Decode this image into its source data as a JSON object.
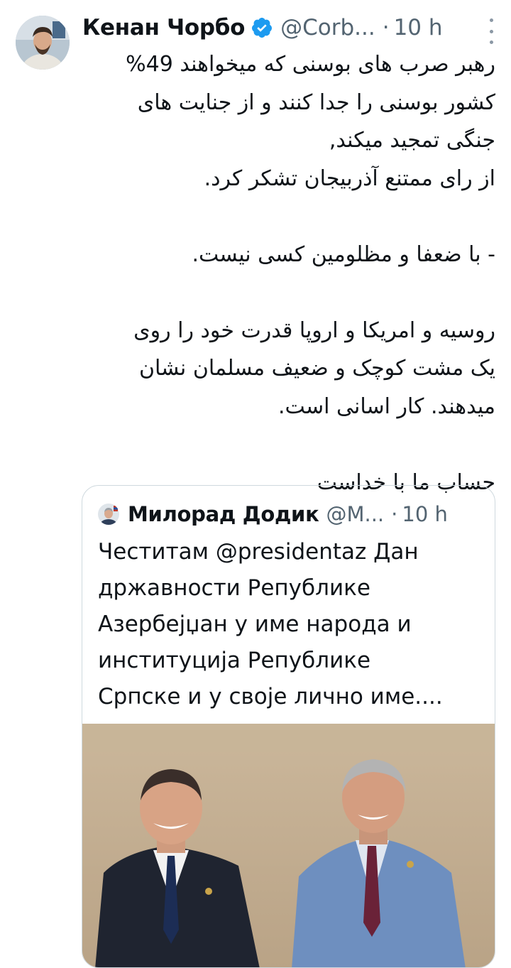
{
  "tweet": {
    "author_name": "Кенан Чорбо",
    "author_handle": "@Corb...",
    "separator": "·",
    "time": "10 h",
    "verified": true,
    "text_lines": [
      "رهبر صرب های بوسنی که میخواهند 49%",
      "کشور بوسنی را جدا کنند و از جنایت های",
      "جنگی تمجید میکند,",
      "از رای ممتنع آذربیجان تشکر کرد.",
      "",
      "- با  ضعفا و مظلومین کسی نیست.",
      "",
      "روسیه و امریکا و اروپا قدرت خود را روی",
      "یک مشت کوچک و ضعیف مسلمان نشان",
      "میدهند. کار اسانی است.",
      "",
      "حساب ما با خداست"
    ]
  },
  "quoted_tweet": {
    "author_name": "Милорад Додик",
    "author_handle": "@M...",
    "separator": "·",
    "time": "10 h",
    "text_lines": [
      "Честитам @presidentaz Дан",
      "државности Републике",
      "Азербејџан у име народа и",
      "институција Републике",
      "Српске и у своје лично име...."
    ]
  },
  "colors": {
    "text": "#0f1419",
    "secondary": "#536471",
    "verified_blue": "#1d9bf0",
    "border": "#cfd9de"
  },
  "icons": {
    "verified": "verified-badge-icon",
    "more": "more-options-icon"
  }
}
